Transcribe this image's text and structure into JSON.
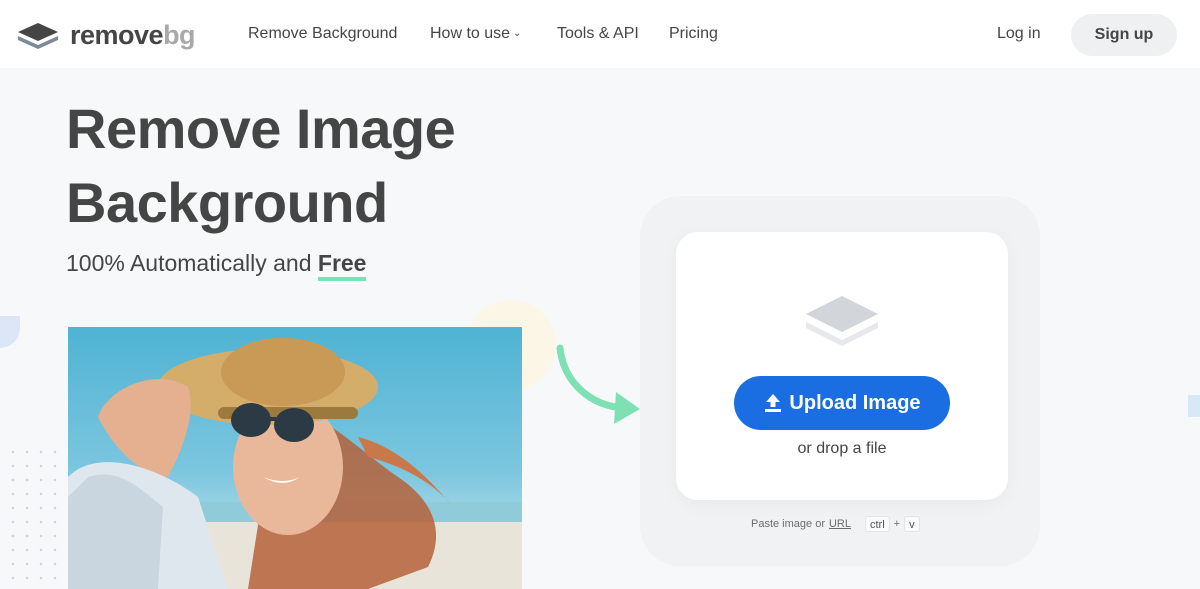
{
  "brand": {
    "name_main": "remove",
    "name_accent": "bg"
  },
  "nav": {
    "remove_background": "Remove Background",
    "how_to_use": "How to use",
    "tools_api": "Tools & API",
    "pricing": "Pricing",
    "login": "Log in",
    "signup": "Sign up"
  },
  "hero": {
    "title_line1": "Remove Image",
    "title_line2": "Background",
    "subtitle_prefix": "100% Automatically and",
    "subtitle_emphasis": "Free"
  },
  "uploader": {
    "button_label": "Upload Image",
    "drop_text": "or drop a file",
    "paste_prefix": "Paste image or",
    "paste_url": "URL",
    "key_ctrl": "ctrl",
    "key_plus": "+",
    "key_v": "v"
  },
  "icons": {
    "logo": "layers-logo-icon",
    "upload": "upload-arrow-icon",
    "stack": "layers-stack-icon",
    "arrow": "curved-arrow-icon",
    "dropdown": "chevron-down-icon"
  },
  "colors": {
    "primary_blue": "#1a6ee2",
    "accent_green": "#6ee7b7",
    "text_dark": "#454545",
    "signup_bg": "#eef0f2"
  }
}
